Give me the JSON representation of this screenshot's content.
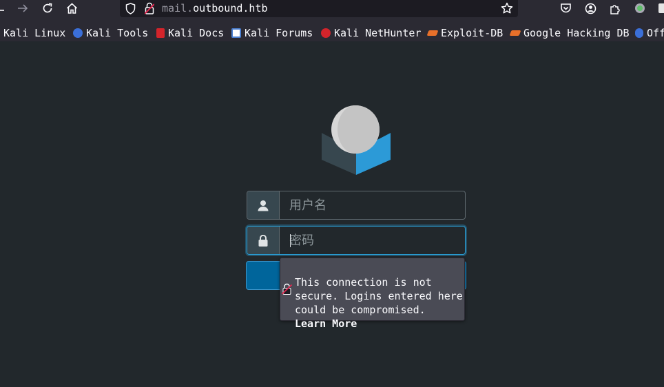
{
  "toolbar": {
    "back_icon": "arrow-left-icon",
    "forward_icon": "arrow-right-icon",
    "reload_icon": "reload-icon",
    "home_icon": "home-icon"
  },
  "urlbar": {
    "url_prefix": "mail.",
    "url_domain": "outbound.htb",
    "shield_icon": "shield-icon",
    "insecure_icon": "insecure-lock-icon",
    "bookmark_icon": "star-icon"
  },
  "extensions": [
    "pocket-icon",
    "account-icon",
    "extensions-icon",
    "extension-dot-icon"
  ],
  "bookmarks": [
    {
      "label": "Kali Linux",
      "color": "#2b2a33"
    },
    {
      "label": "Kali Tools",
      "color": "#3b6fd8"
    },
    {
      "label": "Kali Docs",
      "color": "#d3242b"
    },
    {
      "label": "Kali Forums",
      "color": "#4a7fd0"
    },
    {
      "label": "Kali NetHunter",
      "color": "#d3242b"
    },
    {
      "label": "Exploit-DB",
      "color": "#e8702a"
    },
    {
      "label": "Google Hacking DB",
      "color": "#e8702a"
    },
    {
      "label": "Off",
      "color": "#3b6fd8"
    }
  ],
  "login": {
    "username_placeholder": "用户名",
    "password_placeholder": "密码",
    "login_label": ""
  },
  "popup": {
    "message": "This connection is not secure. Logins entered here could be compromised.",
    "learn_more": "Learn More"
  },
  "colors": {
    "page_bg": "#22282c",
    "accent": "#2a9fd6",
    "button": "#00659b"
  }
}
